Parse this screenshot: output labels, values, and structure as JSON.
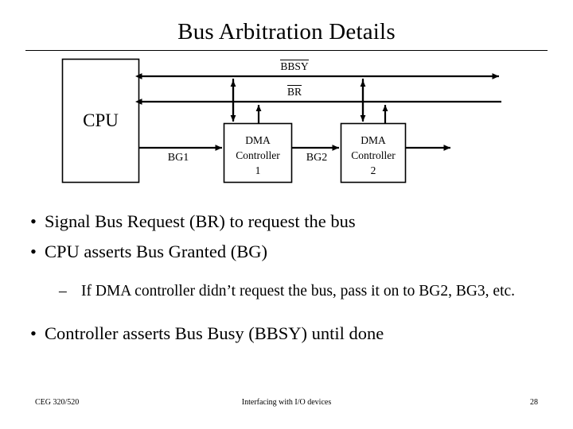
{
  "slide": {
    "title": "Bus Arbitration Details"
  },
  "diagram": {
    "cpu_label": "CPU",
    "dma1_label_line1": "DMA",
    "dma1_label_line2": "Controller",
    "dma1_label_line3": "1",
    "dma2_label_line1": "DMA",
    "dma2_label_line2": "Controller",
    "dma2_label_line3": "2",
    "bg1_label": "BG1",
    "bg2_label": "BG2",
    "bbsy_label": "BBSY",
    "br_label": "BR",
    "line_color": "#000000"
  },
  "body": {
    "bullet_char": "•",
    "dash_char": "–",
    "bullets": [
      {
        "level": 1,
        "text": "Signal Bus Request (BR) to request the bus"
      },
      {
        "level": 1,
        "text": "CPU asserts Bus Granted (BG)"
      },
      {
        "level": 2,
        "text": "If DMA controller didn’t request the bus, pass it on to BG2, BG3, etc."
      },
      {
        "level": 1,
        "text": "Controller asserts Bus Busy (BBSY) until done"
      }
    ]
  },
  "footer": {
    "course": "CEG 320/520",
    "topic": "Interfacing with I/O devices",
    "page_number": "28"
  }
}
